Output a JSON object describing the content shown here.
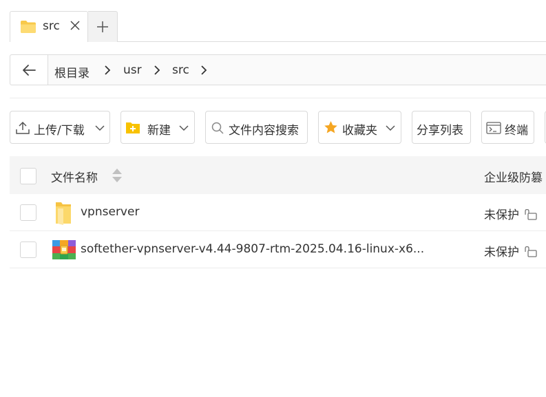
{
  "tabs": [
    {
      "label": "src",
      "icon": "folder-icon"
    }
  ],
  "address_bar": {
    "breadcrumbs": [
      "根目录",
      "usr",
      "src"
    ]
  },
  "toolbar": {
    "upload_download": "上传/下载",
    "new": "新建",
    "search": "文件内容搜索",
    "favorites": "收藏夹",
    "share_list": "分享列表",
    "terminal": "终端"
  },
  "table": {
    "columns": {
      "name": "文件名称",
      "protection": "企业级防篡"
    },
    "rows": [
      {
        "name": "vpnserver",
        "type": "folder",
        "status": "未保护"
      },
      {
        "name": "softether-vpnserver-v4.44-9807-rtm-2025.04.16-linux-x6...",
        "type": "archive",
        "status": "未保护"
      }
    ]
  },
  "colors": {
    "folder": "#f8c94a",
    "star": "#f5a623",
    "border": "#dcdcdc",
    "header_bg": "#f5f5f5"
  }
}
